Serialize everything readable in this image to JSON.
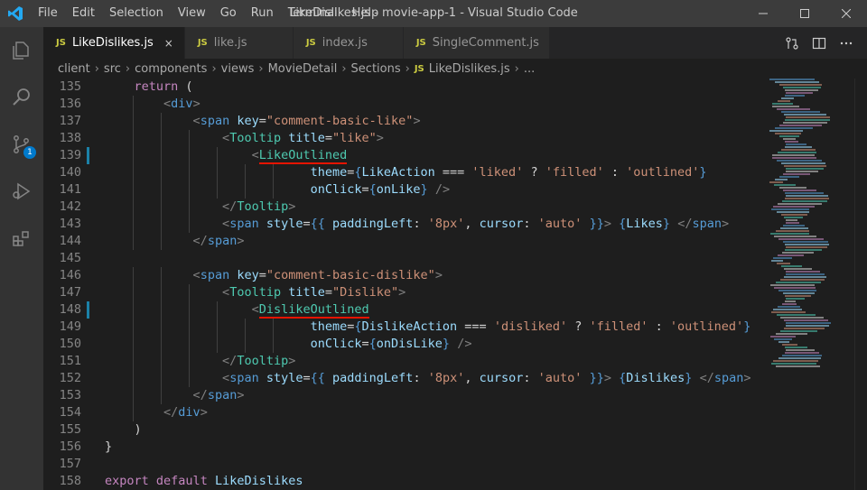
{
  "titlebar": {
    "menu": [
      "File",
      "Edit",
      "Selection",
      "View",
      "Go",
      "Run",
      "Terminal",
      "Help"
    ],
    "title": "LikeDislikes.js - movie-app-1 - Visual Studio Code"
  },
  "activity": {
    "items": [
      "explorer-icon",
      "search-icon",
      "source-control-icon",
      "run-debug-icon",
      "extensions-icon"
    ],
    "scm_badge": "1"
  },
  "tabs": [
    {
      "badge": "JS",
      "label": "LikeDislikes.js",
      "close": "×"
    },
    {
      "badge": "JS",
      "label": "like.js"
    },
    {
      "badge": "JS",
      "label": "index.js"
    },
    {
      "badge": "JS",
      "label": "SingleComment.js"
    }
  ],
  "breadcrumb": {
    "parts": [
      "client",
      "src",
      "components",
      "views",
      "MovieDetail",
      "Sections"
    ],
    "file_badge": "JS",
    "file": "LikeDislikes.js",
    "tail": "..."
  },
  "code": {
    "lines": [
      {
        "n": "135",
        "indent": 1,
        "t": [
          [
            "kw",
            "return"
          ],
          [
            "p",
            " ("
          ]
        ]
      },
      {
        "n": "136",
        "indent": 2,
        "t": [
          [
            "pn",
            "<"
          ],
          [
            "tg",
            "div"
          ],
          [
            "pn",
            ">"
          ]
        ]
      },
      {
        "n": "137",
        "indent": 3,
        "t": [
          [
            "pn",
            "<"
          ],
          [
            "tg",
            "span"
          ],
          [
            "p",
            " "
          ],
          [
            "at",
            "key"
          ],
          [
            "p",
            "="
          ],
          [
            "st",
            "\"comment-basic-like\""
          ],
          [
            "pn",
            ">"
          ]
        ]
      },
      {
        "n": "138",
        "indent": 4,
        "t": [
          [
            "pn",
            "<"
          ],
          [
            "cp",
            "Tooltip"
          ],
          [
            "p",
            " "
          ],
          [
            "at",
            "title"
          ],
          [
            "p",
            "="
          ],
          [
            "st",
            "\"like\""
          ],
          [
            "pn",
            ">"
          ]
        ]
      },
      {
        "n": "139",
        "indent": 5,
        "mark": true,
        "t": [
          [
            "pn",
            "<"
          ],
          [
            "cps",
            "LikeOutlined"
          ]
        ]
      },
      {
        "n": "140",
        "indent": 7,
        "t": [
          [
            "at",
            "theme"
          ],
          [
            "p",
            "="
          ],
          [
            "br",
            "{"
          ],
          [
            "id",
            "LikeAction"
          ],
          [
            "p",
            " === "
          ],
          [
            "st",
            "'liked'"
          ],
          [
            "p",
            " ? "
          ],
          [
            "st",
            "'filled'"
          ],
          [
            "p",
            " : "
          ],
          [
            "st",
            "'outlined'"
          ],
          [
            "br",
            "}"
          ]
        ]
      },
      {
        "n": "141",
        "indent": 7,
        "t": [
          [
            "at",
            "onClick"
          ],
          [
            "p",
            "="
          ],
          [
            "br",
            "{"
          ],
          [
            "id",
            "onLike"
          ],
          [
            "br",
            "}"
          ],
          [
            "p",
            " "
          ],
          [
            "pn",
            "/>"
          ]
        ]
      },
      {
        "n": "142",
        "indent": 4,
        "t": [
          [
            "pn",
            "</"
          ],
          [
            "cp",
            "Tooltip"
          ],
          [
            "pn",
            ">"
          ]
        ]
      },
      {
        "n": "143",
        "indent": 4,
        "t": [
          [
            "pn",
            "<"
          ],
          [
            "tg",
            "span"
          ],
          [
            "p",
            " "
          ],
          [
            "at",
            "style"
          ],
          [
            "p",
            "="
          ],
          [
            "br",
            "{{"
          ],
          [
            "p",
            " "
          ],
          [
            "id",
            "paddingLeft"
          ],
          [
            "p",
            ": "
          ],
          [
            "st",
            "'8px'"
          ],
          [
            "p",
            ", "
          ],
          [
            "id",
            "cursor"
          ],
          [
            "p",
            ": "
          ],
          [
            "st",
            "'auto'"
          ],
          [
            "p",
            " "
          ],
          [
            "br",
            "}}"
          ],
          [
            "pn",
            ">"
          ],
          [
            "p",
            " "
          ],
          [
            "br",
            "{"
          ],
          [
            "id",
            "Likes"
          ],
          [
            "br",
            "}"
          ],
          [
            "p",
            " "
          ],
          [
            "pn",
            "</"
          ],
          [
            "tg",
            "span"
          ],
          [
            "pn",
            ">"
          ]
        ]
      },
      {
        "n": "144",
        "indent": 3,
        "t": [
          [
            "pn",
            "</"
          ],
          [
            "tg",
            "span"
          ],
          [
            "pn",
            ">"
          ]
        ]
      },
      {
        "n": "145",
        "indent": 0,
        "t": []
      },
      {
        "n": "146",
        "indent": 3,
        "t": [
          [
            "pn",
            "<"
          ],
          [
            "tg",
            "span"
          ],
          [
            "p",
            " "
          ],
          [
            "at",
            "key"
          ],
          [
            "p",
            "="
          ],
          [
            "st",
            "\"comment-basic-dislike\""
          ],
          [
            "pn",
            ">"
          ]
        ]
      },
      {
        "n": "147",
        "indent": 4,
        "t": [
          [
            "pn",
            "<"
          ],
          [
            "cp",
            "Tooltip"
          ],
          [
            "p",
            " "
          ],
          [
            "at",
            "title"
          ],
          [
            "p",
            "="
          ],
          [
            "st",
            "\"Dislike\""
          ],
          [
            "pn",
            ">"
          ]
        ]
      },
      {
        "n": "148",
        "indent": 5,
        "mark": true,
        "t": [
          [
            "pn",
            "<"
          ],
          [
            "cps",
            "DislikeOutlined"
          ]
        ]
      },
      {
        "n": "149",
        "indent": 7,
        "t": [
          [
            "at",
            "theme"
          ],
          [
            "p",
            "="
          ],
          [
            "br",
            "{"
          ],
          [
            "id",
            "DislikeAction"
          ],
          [
            "p",
            " === "
          ],
          [
            "st",
            "'disliked'"
          ],
          [
            "p",
            " ? "
          ],
          [
            "st",
            "'filled'"
          ],
          [
            "p",
            " : "
          ],
          [
            "st",
            "'outlined'"
          ],
          [
            "br",
            "}"
          ]
        ]
      },
      {
        "n": "150",
        "indent": 7,
        "t": [
          [
            "at",
            "onClick"
          ],
          [
            "p",
            "="
          ],
          [
            "br",
            "{"
          ],
          [
            "id",
            "onDisLike"
          ],
          [
            "br",
            "}"
          ],
          [
            "p",
            " "
          ],
          [
            "pn",
            "/>"
          ]
        ]
      },
      {
        "n": "151",
        "indent": 4,
        "t": [
          [
            "pn",
            "</"
          ],
          [
            "cp",
            "Tooltip"
          ],
          [
            "pn",
            ">"
          ]
        ]
      },
      {
        "n": "152",
        "indent": 4,
        "t": [
          [
            "pn",
            "<"
          ],
          [
            "tg",
            "span"
          ],
          [
            "p",
            " "
          ],
          [
            "at",
            "style"
          ],
          [
            "p",
            "="
          ],
          [
            "br",
            "{{"
          ],
          [
            "p",
            " "
          ],
          [
            "id",
            "paddingLeft"
          ],
          [
            "p",
            ": "
          ],
          [
            "st",
            "'8px'"
          ],
          [
            "p",
            ", "
          ],
          [
            "id",
            "cursor"
          ],
          [
            "p",
            ": "
          ],
          [
            "st",
            "'auto'"
          ],
          [
            "p",
            " "
          ],
          [
            "br",
            "}}"
          ],
          [
            "pn",
            ">"
          ],
          [
            "p",
            " "
          ],
          [
            "br",
            "{"
          ],
          [
            "id",
            "Dislikes"
          ],
          [
            "br",
            "}"
          ],
          [
            "p",
            " "
          ],
          [
            "pn",
            "</"
          ],
          [
            "tg",
            "span"
          ],
          [
            "pn",
            ">"
          ]
        ]
      },
      {
        "n": "153",
        "indent": 3,
        "t": [
          [
            "pn",
            "</"
          ],
          [
            "tg",
            "span"
          ],
          [
            "pn",
            ">"
          ]
        ]
      },
      {
        "n": "154",
        "indent": 2,
        "t": [
          [
            "pn",
            "</"
          ],
          [
            "tg",
            "div"
          ],
          [
            "pn",
            ">"
          ]
        ]
      },
      {
        "n": "155",
        "indent": 1,
        "t": [
          [
            "p",
            ")"
          ]
        ]
      },
      {
        "n": "156",
        "indent": 0,
        "t": [
          [
            "p",
            "}"
          ]
        ]
      },
      {
        "n": "157",
        "indent": 0,
        "t": []
      },
      {
        "n": "158",
        "indent": 0,
        "t": [
          [
            "kw",
            "export"
          ],
          [
            "p",
            " "
          ],
          [
            "kw",
            "default"
          ],
          [
            "p",
            " "
          ],
          [
            "id",
            "LikeDislikes"
          ]
        ]
      }
    ]
  },
  "colors": {
    "kw": "#c586c0",
    "tg": "#569cd6",
    "cp": "#4ec9b0",
    "at": "#9cdcfe",
    "st": "#ce9178",
    "pn": "#808080",
    "br": "#569cd6",
    "id": "#9cdcfe",
    "p": "#d4d4d4"
  }
}
